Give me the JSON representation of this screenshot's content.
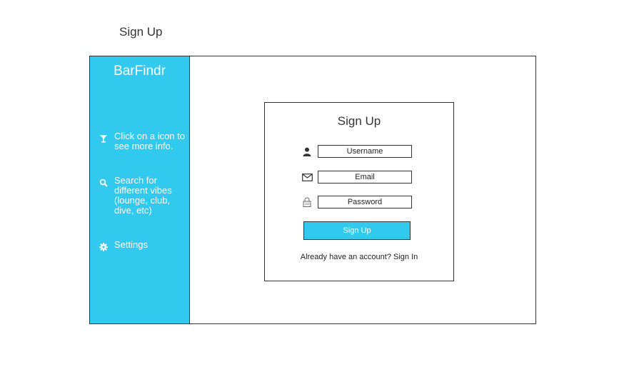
{
  "page": {
    "title": "Sign Up"
  },
  "sidebar": {
    "brand": "BarFindr",
    "items": [
      {
        "icon": "cocktail-glass-icon",
        "label": "Click on a icon to see more info."
      },
      {
        "icon": "search-icon",
        "label": "Search for different vibes (lounge, club, dive, etc)"
      },
      {
        "icon": "gear-icon",
        "label": "Settings"
      }
    ]
  },
  "form": {
    "title": "Sign Up",
    "username": {
      "icon": "user-icon",
      "placeholder": "Username",
      "value": ""
    },
    "email": {
      "icon": "envelope-icon",
      "placeholder": "Email",
      "value": ""
    },
    "password": {
      "icon": "lock-icon",
      "placeholder": "Password",
      "value": ""
    },
    "submit_label": "Sign Up",
    "signin_prompt": "Already have an account?",
    "signin_link": "Sign In"
  },
  "colors": {
    "accent": "#31c9ee",
    "border": "#333333"
  }
}
